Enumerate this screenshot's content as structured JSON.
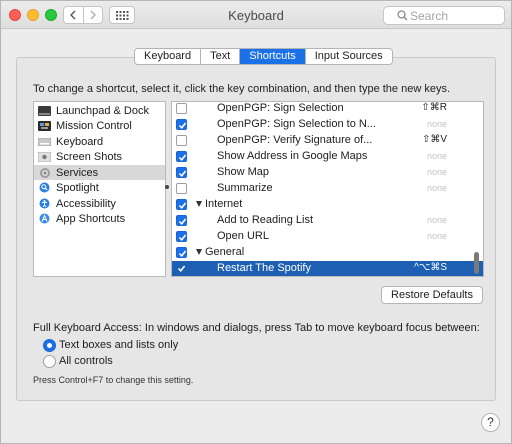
{
  "window": {
    "title": "Keyboard"
  },
  "search": {
    "placeholder": "Search"
  },
  "tabs": [
    {
      "label": "Keyboard",
      "active": false
    },
    {
      "label": "Text",
      "active": false
    },
    {
      "label": "Shortcuts",
      "active": true
    },
    {
      "label": "Input Sources",
      "active": false
    }
  ],
  "instructions": "To change a shortcut, select it, click the key combination, and then type the new keys.",
  "categories": [
    {
      "label": "Launchpad & Dock",
      "icon": "launchpad-icon"
    },
    {
      "label": "Mission Control",
      "icon": "mission-control-icon"
    },
    {
      "label": "Keyboard",
      "icon": "keyboard-icon"
    },
    {
      "label": "Screen Shots",
      "icon": "screenshot-icon"
    },
    {
      "label": "Services",
      "icon": "gear-icon",
      "selected": true
    },
    {
      "label": "Spotlight",
      "icon": "spotlight-icon"
    },
    {
      "label": "Accessibility",
      "icon": "accessibility-icon"
    },
    {
      "label": "App Shortcuts",
      "icon": "app-shortcuts-icon"
    }
  ],
  "shortcuts": [
    {
      "label": "OpenPGP: Sign Selection",
      "key": "⇧⌘R",
      "checked": false
    },
    {
      "label": "OpenPGP: Sign Selection to N...",
      "key": "none",
      "checked": true
    },
    {
      "label": "OpenPGP: Verify Signature of...",
      "key": "⇧⌘V",
      "checked": false
    },
    {
      "label": "Show Address in Google Maps",
      "key": "none",
      "checked": true
    },
    {
      "label": "Show Map",
      "key": "none",
      "checked": true
    },
    {
      "label": "Summarize",
      "key": "none",
      "checked": false
    },
    {
      "label": "Internet",
      "key": "",
      "checked": true,
      "group": true
    },
    {
      "label": "Add to Reading List",
      "key": "none",
      "checked": true
    },
    {
      "label": "Open URL",
      "key": "none",
      "checked": true
    },
    {
      "label": "General",
      "key": "",
      "checked": true,
      "group": true
    },
    {
      "label": "Restart The Spotify",
      "key": "^⌥⌘S",
      "checked": true,
      "selected": true
    }
  ],
  "restore_label": "Restore Defaults",
  "full_keyboard_access": {
    "label": "Full Keyboard Access: In windows and dialogs, press Tab to move keyboard focus between:",
    "options": [
      {
        "label": "Text boxes and lists only",
        "selected": true
      },
      {
        "label": "All controls",
        "selected": false
      }
    ],
    "hint": "Press Control+F7 to change this setting."
  },
  "help_label": "?",
  "colors": {
    "accent": "#1b72e8",
    "selection": "#1c5fb3"
  }
}
